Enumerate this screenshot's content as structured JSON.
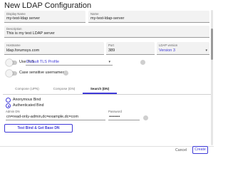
{
  "dialog": {
    "title": "New LDAP Configuration",
    "cancel_label": "Cancel",
    "create_label": "Create"
  },
  "form": {
    "display_name": {
      "label": "Display Name",
      "value": "my-test-ldap server"
    },
    "name": {
      "label": "Name",
      "value": "my-test-ldap-server"
    },
    "description": {
      "label": "Description",
      "value": "This is my test LDAP server"
    },
    "hostname": {
      "label": "Hostname",
      "value": "ldap.forumsys.com"
    },
    "port": {
      "label": "Port",
      "value": "389"
    },
    "ldap_version": {
      "label": "LDAP version",
      "value": "Version 3"
    },
    "use_tls": {
      "label": "Use TLS",
      "enabled": false
    },
    "tls_profile": {
      "value": "Default TLS Profile"
    },
    "case_sensitive": {
      "label": "Case sensitive usernames",
      "enabled": false
    }
  },
  "tabs": {
    "items": [
      "Compose (UPN)",
      "Compose (DN)",
      "Search (DN)"
    ],
    "active": "Search (DN)"
  },
  "bind": {
    "anonymous_label": "Anonymous Bind",
    "authenticated_label": "Authenticated Bind",
    "selected": "Authenticated Bind",
    "admin_dn": {
      "label": "Admin DN",
      "value": "cn=read-only-admin,dc=example,dc=com"
    },
    "password": {
      "label": "Password",
      "value": "••••••••"
    },
    "test_button_label": "Test Bind & Get Base DN"
  },
  "colors": {
    "accent": "#3f3ad8",
    "field_bg": "#f2f2f2"
  }
}
